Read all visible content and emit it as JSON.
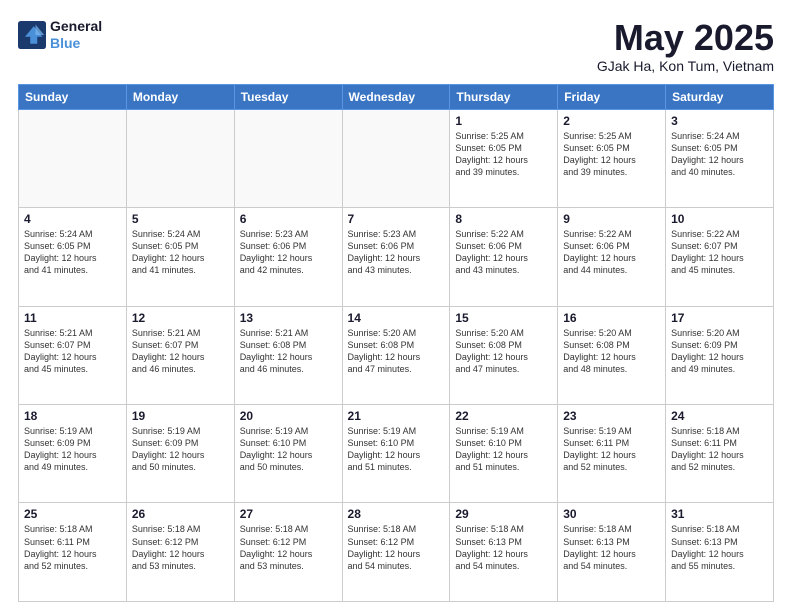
{
  "header": {
    "logo_line1": "General",
    "logo_line2": "Blue",
    "month_title": "May 2025",
    "subtitle": "GJak Ha, Kon Tum, Vietnam"
  },
  "days_of_week": [
    "Sunday",
    "Monday",
    "Tuesday",
    "Wednesday",
    "Thursday",
    "Friday",
    "Saturday"
  ],
  "weeks": [
    [
      {
        "day": "",
        "info": ""
      },
      {
        "day": "",
        "info": ""
      },
      {
        "day": "",
        "info": ""
      },
      {
        "day": "",
        "info": ""
      },
      {
        "day": "1",
        "info": "Sunrise: 5:25 AM\nSunset: 6:05 PM\nDaylight: 12 hours\nand 39 minutes."
      },
      {
        "day": "2",
        "info": "Sunrise: 5:25 AM\nSunset: 6:05 PM\nDaylight: 12 hours\nand 39 minutes."
      },
      {
        "day": "3",
        "info": "Sunrise: 5:24 AM\nSunset: 6:05 PM\nDaylight: 12 hours\nand 40 minutes."
      }
    ],
    [
      {
        "day": "4",
        "info": "Sunrise: 5:24 AM\nSunset: 6:05 PM\nDaylight: 12 hours\nand 41 minutes."
      },
      {
        "day": "5",
        "info": "Sunrise: 5:24 AM\nSunset: 6:05 PM\nDaylight: 12 hours\nand 41 minutes."
      },
      {
        "day": "6",
        "info": "Sunrise: 5:23 AM\nSunset: 6:06 PM\nDaylight: 12 hours\nand 42 minutes."
      },
      {
        "day": "7",
        "info": "Sunrise: 5:23 AM\nSunset: 6:06 PM\nDaylight: 12 hours\nand 43 minutes."
      },
      {
        "day": "8",
        "info": "Sunrise: 5:22 AM\nSunset: 6:06 PM\nDaylight: 12 hours\nand 43 minutes."
      },
      {
        "day": "9",
        "info": "Sunrise: 5:22 AM\nSunset: 6:06 PM\nDaylight: 12 hours\nand 44 minutes."
      },
      {
        "day": "10",
        "info": "Sunrise: 5:22 AM\nSunset: 6:07 PM\nDaylight: 12 hours\nand 45 minutes."
      }
    ],
    [
      {
        "day": "11",
        "info": "Sunrise: 5:21 AM\nSunset: 6:07 PM\nDaylight: 12 hours\nand 45 minutes."
      },
      {
        "day": "12",
        "info": "Sunrise: 5:21 AM\nSunset: 6:07 PM\nDaylight: 12 hours\nand 46 minutes."
      },
      {
        "day": "13",
        "info": "Sunrise: 5:21 AM\nSunset: 6:08 PM\nDaylight: 12 hours\nand 46 minutes."
      },
      {
        "day": "14",
        "info": "Sunrise: 5:20 AM\nSunset: 6:08 PM\nDaylight: 12 hours\nand 47 minutes."
      },
      {
        "day": "15",
        "info": "Sunrise: 5:20 AM\nSunset: 6:08 PM\nDaylight: 12 hours\nand 47 minutes."
      },
      {
        "day": "16",
        "info": "Sunrise: 5:20 AM\nSunset: 6:08 PM\nDaylight: 12 hours\nand 48 minutes."
      },
      {
        "day": "17",
        "info": "Sunrise: 5:20 AM\nSunset: 6:09 PM\nDaylight: 12 hours\nand 49 minutes."
      }
    ],
    [
      {
        "day": "18",
        "info": "Sunrise: 5:19 AM\nSunset: 6:09 PM\nDaylight: 12 hours\nand 49 minutes."
      },
      {
        "day": "19",
        "info": "Sunrise: 5:19 AM\nSunset: 6:09 PM\nDaylight: 12 hours\nand 50 minutes."
      },
      {
        "day": "20",
        "info": "Sunrise: 5:19 AM\nSunset: 6:10 PM\nDaylight: 12 hours\nand 50 minutes."
      },
      {
        "day": "21",
        "info": "Sunrise: 5:19 AM\nSunset: 6:10 PM\nDaylight: 12 hours\nand 51 minutes."
      },
      {
        "day": "22",
        "info": "Sunrise: 5:19 AM\nSunset: 6:10 PM\nDaylight: 12 hours\nand 51 minutes."
      },
      {
        "day": "23",
        "info": "Sunrise: 5:19 AM\nSunset: 6:11 PM\nDaylight: 12 hours\nand 52 minutes."
      },
      {
        "day": "24",
        "info": "Sunrise: 5:18 AM\nSunset: 6:11 PM\nDaylight: 12 hours\nand 52 minutes."
      }
    ],
    [
      {
        "day": "25",
        "info": "Sunrise: 5:18 AM\nSunset: 6:11 PM\nDaylight: 12 hours\nand 52 minutes."
      },
      {
        "day": "26",
        "info": "Sunrise: 5:18 AM\nSunset: 6:12 PM\nDaylight: 12 hours\nand 53 minutes."
      },
      {
        "day": "27",
        "info": "Sunrise: 5:18 AM\nSunset: 6:12 PM\nDaylight: 12 hours\nand 53 minutes."
      },
      {
        "day": "28",
        "info": "Sunrise: 5:18 AM\nSunset: 6:12 PM\nDaylight: 12 hours\nand 54 minutes."
      },
      {
        "day": "29",
        "info": "Sunrise: 5:18 AM\nSunset: 6:13 PM\nDaylight: 12 hours\nand 54 minutes."
      },
      {
        "day": "30",
        "info": "Sunrise: 5:18 AM\nSunset: 6:13 PM\nDaylight: 12 hours\nand 54 minutes."
      },
      {
        "day": "31",
        "info": "Sunrise: 5:18 AM\nSunset: 6:13 PM\nDaylight: 12 hours\nand 55 minutes."
      }
    ]
  ]
}
